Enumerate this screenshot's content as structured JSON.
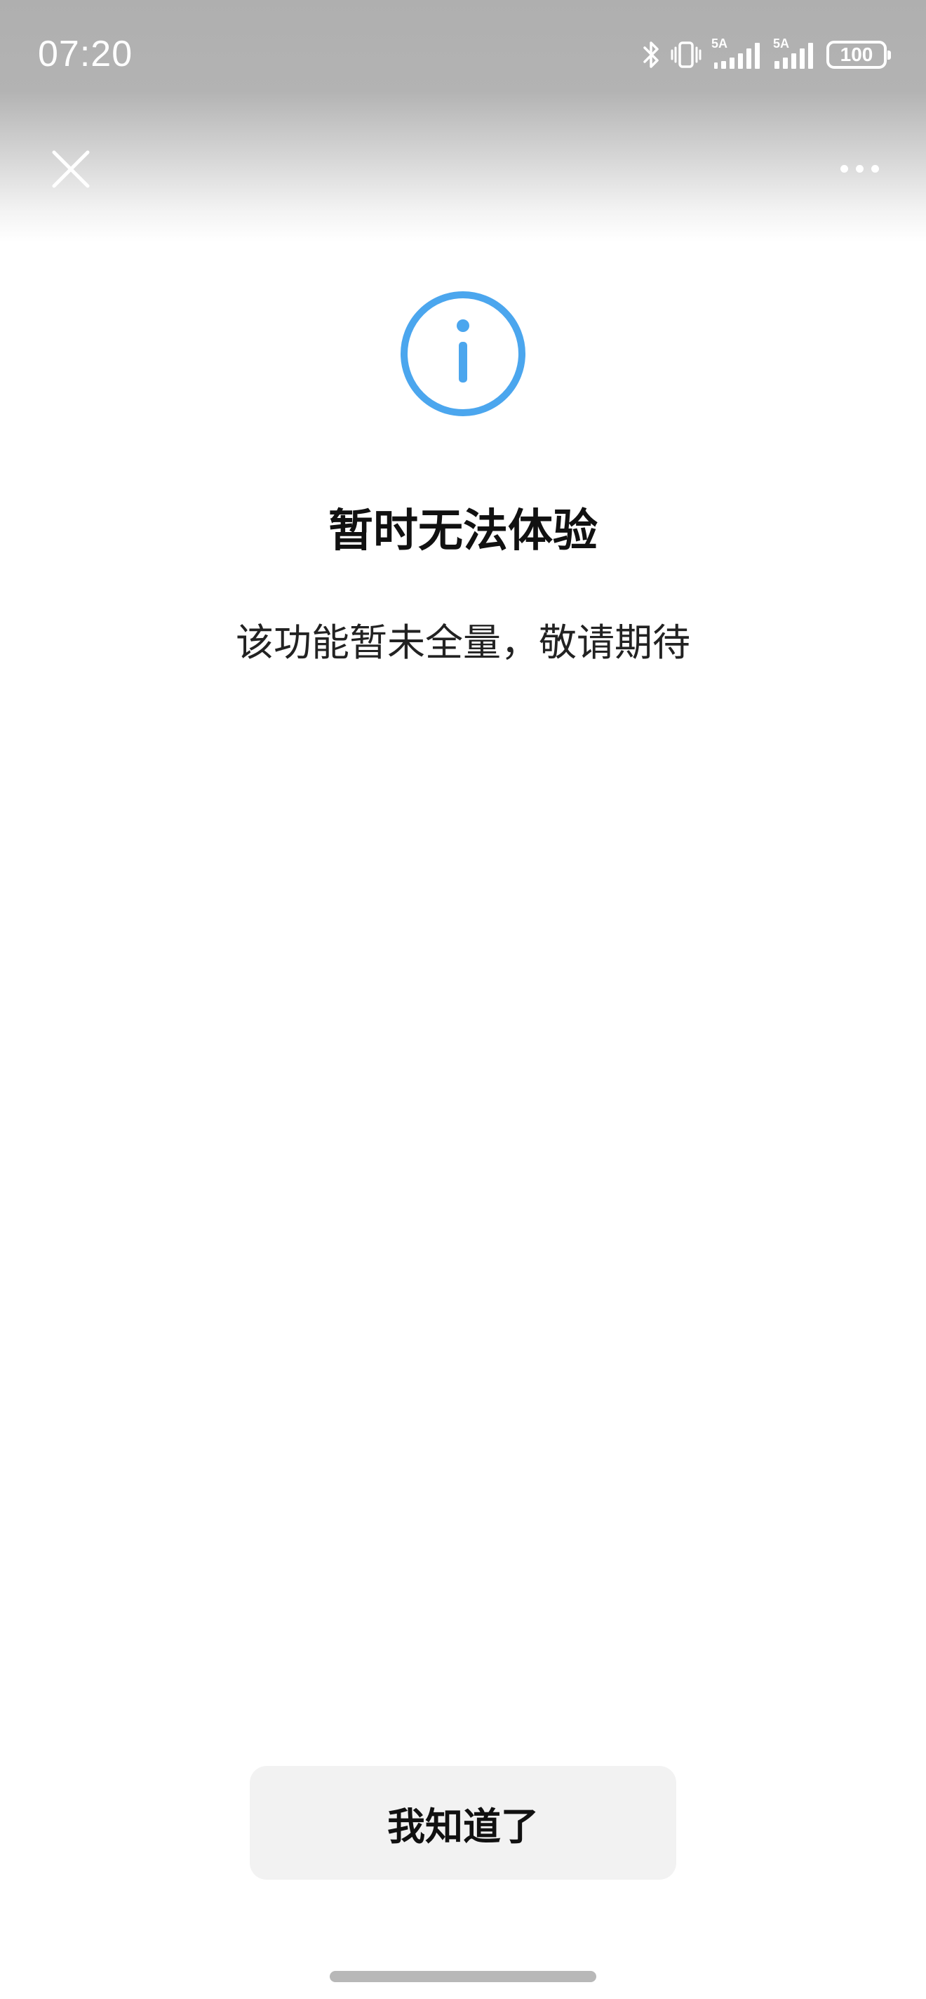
{
  "status_bar": {
    "time": "07:20",
    "sim1_label": "5A",
    "sim2_label": "5A",
    "battery": "100"
  },
  "nav": {
    "close_icon": "close-icon",
    "more_icon": "more-dots-icon"
  },
  "content": {
    "icon": "info-circle-icon",
    "title": "暂时无法体验",
    "message": "该功能暂未全量，敬请期待"
  },
  "actions": {
    "ok_label": "我知道了"
  },
  "colors": {
    "accent": "#4BA6EE",
    "button_bg": "#F2F2F2",
    "header_gray": "#AFAFAF"
  }
}
